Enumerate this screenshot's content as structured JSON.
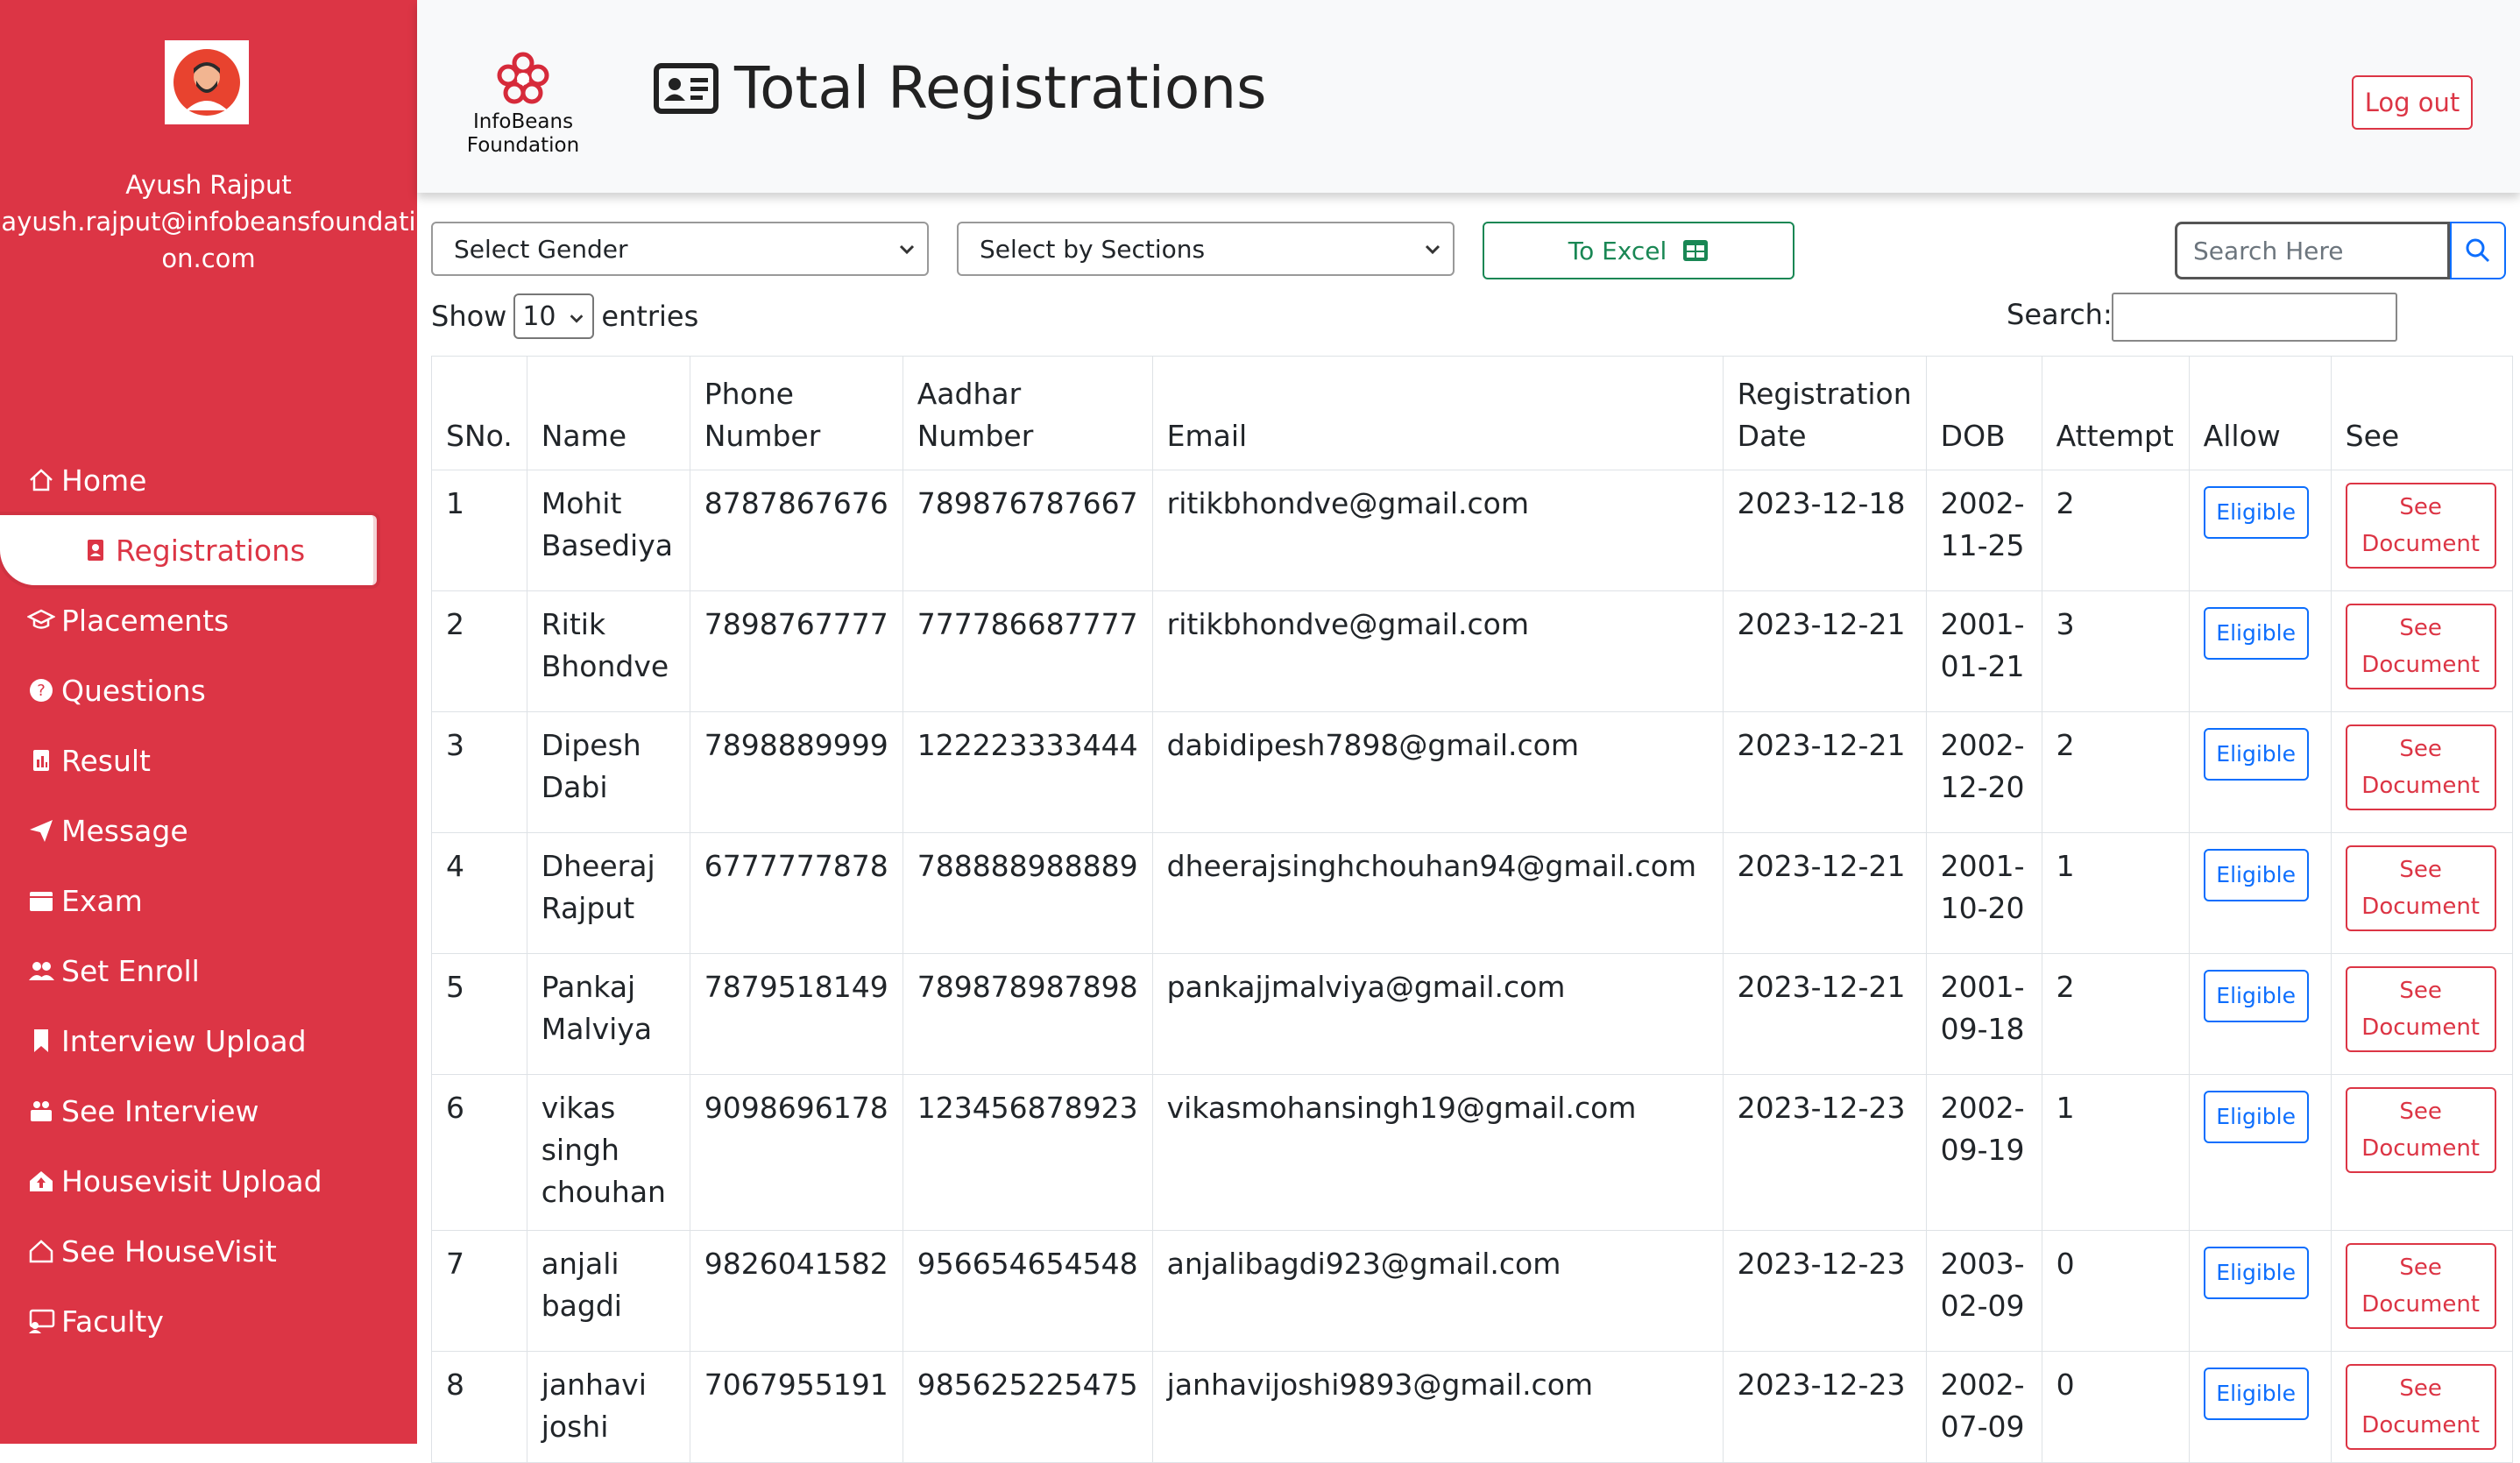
{
  "sidebar": {
    "user_name": "Ayush Rajput",
    "user_email": "ayush.rajput@infobeansfoundation.com",
    "items": [
      {
        "label": "Home",
        "icon": "home-icon"
      },
      {
        "label": "Registrations",
        "icon": "registrations-icon"
      },
      {
        "label": "Placements",
        "icon": "placements-icon"
      },
      {
        "label": "Questions",
        "icon": "question-icon"
      },
      {
        "label": "Result",
        "icon": "result-icon"
      },
      {
        "label": "Message",
        "icon": "send-icon"
      },
      {
        "label": "Exam",
        "icon": "exam-icon"
      },
      {
        "label": "Set Enroll",
        "icon": "users-icon"
      },
      {
        "label": "Interview Upload",
        "icon": "bookmark-icon"
      },
      {
        "label": "See Interview",
        "icon": "interview-icon"
      },
      {
        "label": "Housevisit Upload",
        "icon": "house-upload-icon"
      },
      {
        "label": "See HouseVisit",
        "icon": "house-icon"
      },
      {
        "label": "Faculty",
        "icon": "faculty-icon"
      }
    ],
    "active_index": 1
  },
  "header": {
    "brand_line1": "InfoBeans",
    "brand_line2": "Foundation",
    "title": "Total Registrations",
    "logout_label": "Log out"
  },
  "filters": {
    "gender_select": "Select Gender",
    "section_select": "Select by Sections",
    "excel_label": "To Excel",
    "search_placeholder": "Search Here"
  },
  "datatable": {
    "show_label": "Show",
    "entries_value": "10",
    "entries_label": "entries",
    "search_label": "Search:"
  },
  "table": {
    "columns": [
      "SNo.",
      "Name",
      "Phone Number",
      "Aadhar Number",
      "Email",
      "Registration Date",
      "DOB",
      "Attempt",
      "Allow",
      "See"
    ],
    "eligible_label": "Eligible",
    "see_doc_label": "See Document",
    "rows": [
      {
        "sno": "1",
        "name": "Mohit Basediya",
        "phone": "8787867676",
        "aadhar": "789876787667",
        "email": "ritikbhondve@gmail.com",
        "reg_date": "2023-12-18",
        "dob": "2002-11-25",
        "attempt": "2"
      },
      {
        "sno": "2",
        "name": "Ritik Bhondve",
        "phone": "7898767777",
        "aadhar": "777786687777",
        "email": "ritikbhondve@gmail.com",
        "reg_date": "2023-12-21",
        "dob": "2001-01-21",
        "attempt": "3"
      },
      {
        "sno": "3",
        "name": "Dipesh Dabi",
        "phone": "7898889999",
        "aadhar": "122223333444",
        "email": "dabidipesh7898@gmail.com",
        "reg_date": "2023-12-21",
        "dob": "2002-12-20",
        "attempt": "2"
      },
      {
        "sno": "4",
        "name": "Dheeraj Rajput",
        "phone": "6777777878",
        "aadhar": "788888988889",
        "email": "dheerajsinghchouhan94@gmail.com",
        "reg_date": "2023-12-21",
        "dob": "2001-10-20",
        "attempt": "1"
      },
      {
        "sno": "5",
        "name": "Pankaj Malviya",
        "phone": "7879518149",
        "aadhar": "789878987898",
        "email": "pankajjmalviya@gmail.com",
        "reg_date": "2023-12-21",
        "dob": "2001-09-18",
        "attempt": "2"
      },
      {
        "sno": "6",
        "name": "vikas singh chouhan",
        "phone": "9098696178",
        "aadhar": "123456878923",
        "email": "vikasmohansingh19@gmail.com",
        "reg_date": "2023-12-23",
        "dob": "2002-09-19",
        "attempt": "1"
      },
      {
        "sno": "7",
        "name": "anjali bagdi",
        "phone": "9826041582",
        "aadhar": "956654654548",
        "email": "anjalibagdi923@gmail.com",
        "reg_date": "2023-12-23",
        "dob": "2003-02-09",
        "attempt": "0"
      },
      {
        "sno": "8",
        "name": "janhavi joshi",
        "phone": "7067955191",
        "aadhar": "985625225475",
        "email": "janhavijoshi9893@gmail.com",
        "reg_date": "2023-12-23",
        "dob": "2002-07-09",
        "attempt": "0"
      }
    ]
  },
  "colors": {
    "sidebar_bg": "#dc3545",
    "primary": "#0d6efd",
    "success": "#198754",
    "danger": "#dc3545"
  }
}
